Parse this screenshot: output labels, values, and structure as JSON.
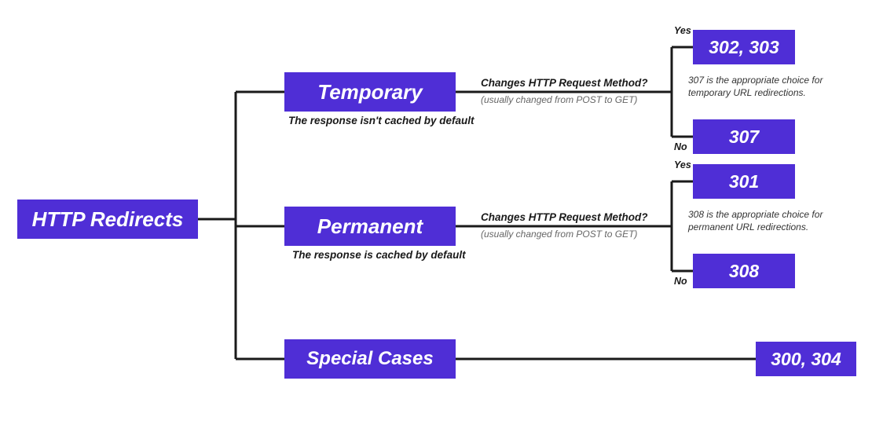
{
  "root": {
    "label": "HTTP Redirects"
  },
  "temporary": {
    "label": "Temporary",
    "subtitle": "The response isn't cached by default",
    "question": "Changes HTTP Request Method?",
    "question_sub": "(usually changed from POST to GET)",
    "yes_label": "Yes",
    "no_label": "No",
    "yes_codes": "302, 303",
    "no_codes": "307",
    "note": "307 is the appropriate choice for temporary URL redirections."
  },
  "permanent": {
    "label": "Permanent",
    "subtitle": "The response is cached by default",
    "question": "Changes HTTP Request Method?",
    "question_sub": "(usually changed from POST to GET)",
    "yes_label": "Yes",
    "no_label": "No",
    "yes_codes": "301",
    "no_codes": "308",
    "note": "308 is the appropriate choice for permanent URL redirections."
  },
  "special": {
    "label": "Special Cases",
    "codes": "300, 304"
  }
}
